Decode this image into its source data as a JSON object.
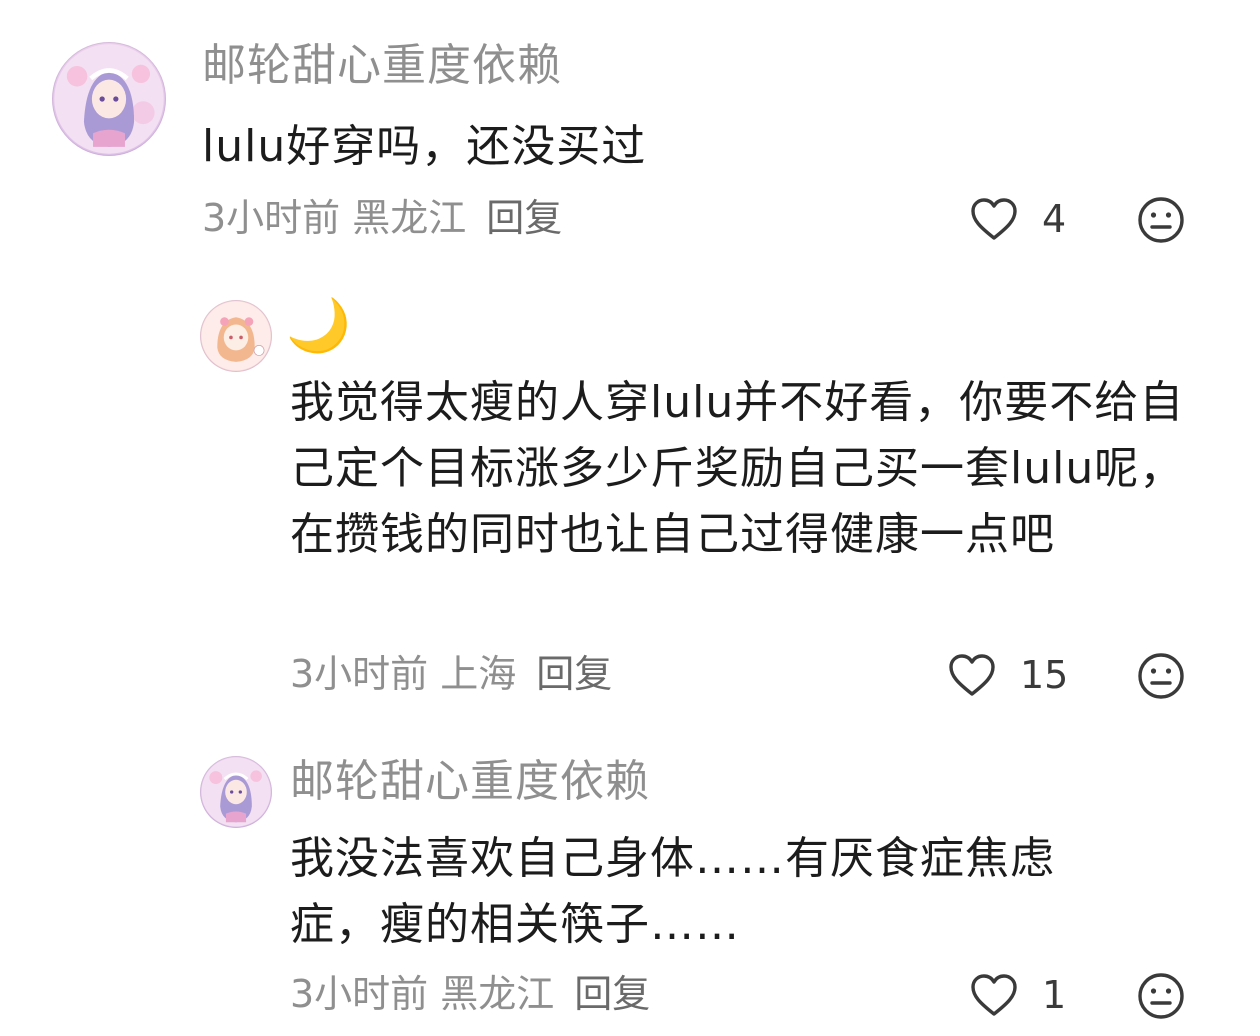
{
  "comments": [
    {
      "username": "邮轮甜心重度依赖",
      "text": "lulu好穿吗，还没买过",
      "time": "3小时前",
      "location": "黑龙江",
      "reply_label": "回复",
      "likes": "4"
    },
    {
      "username": "🌙",
      "text": "我觉得太瘦的人穿lulu并不好看，你要不给自己定个目标涨多少斤奖励自己买一套lulu呢，在攒钱的同时也让自己过得健康一点吧",
      "time": "3小时前",
      "location": "上海",
      "reply_label": "回复",
      "likes": "15"
    },
    {
      "username": "邮轮甜心重度依赖",
      "text": "我没法喜欢自己身体……有厌食症焦虑症，瘦的相关筷子……",
      "time": "3小时前",
      "location": "黑龙江",
      "reply_label": "回复",
      "likes": "1"
    }
  ],
  "icons": {
    "like": "heart-outline-icon",
    "dislike": "neutral-face-icon"
  },
  "colors": {
    "username": "#8f8f8f",
    "text": "#1c1c1c",
    "meta": "#8f8f8f",
    "icon": "#3a3a3a"
  }
}
